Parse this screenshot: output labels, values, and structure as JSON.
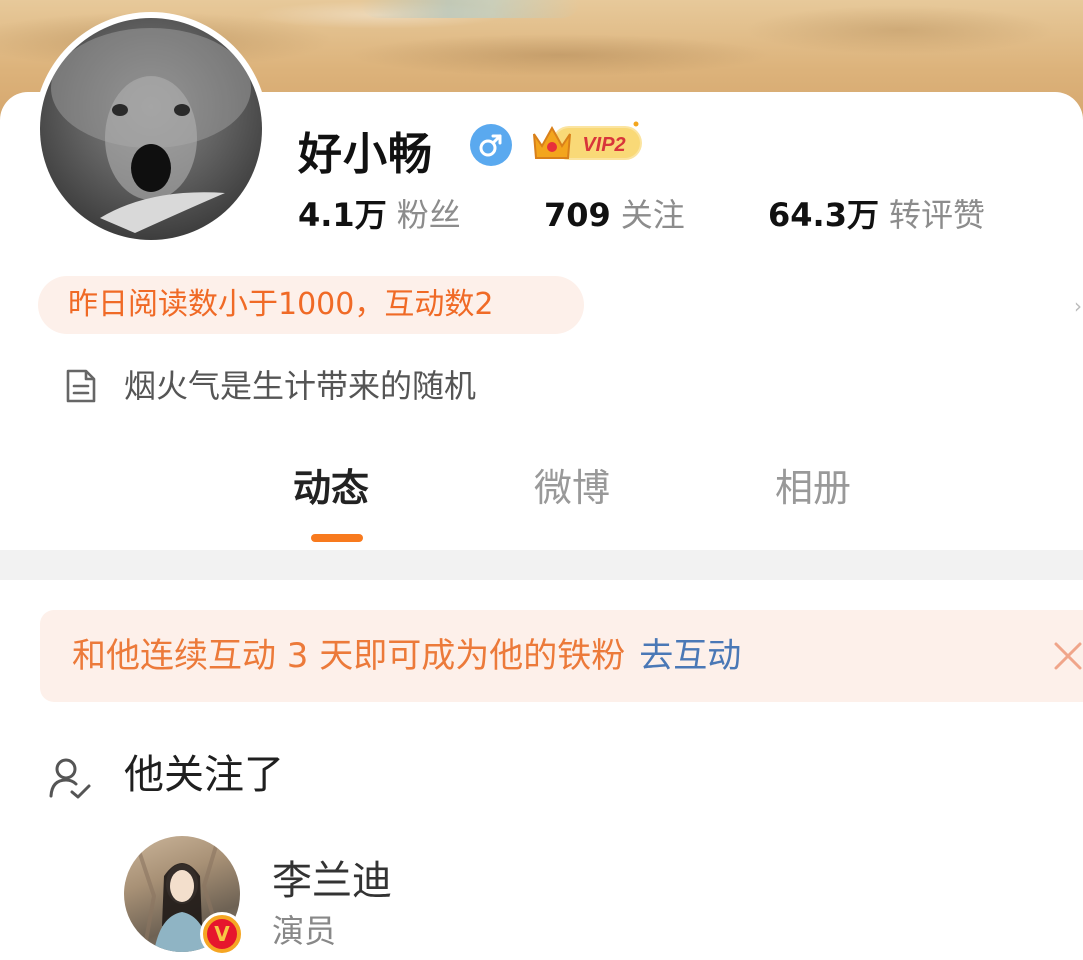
{
  "profile": {
    "name": "好小畅",
    "gender_icon": "male-icon",
    "vip_label": "VIP2",
    "stats": [
      {
        "value": "4.1万",
        "label": "粉丝"
      },
      {
        "value": "709",
        "label": "关注"
      },
      {
        "value": "64.3万",
        "label": "转评赞"
      }
    ],
    "reading_note": "昨日阅读数小于1000，互动数2",
    "bio": "烟火气是生计带来的随机"
  },
  "tabs": [
    {
      "label": "动态",
      "active": true
    },
    {
      "label": "微博",
      "active": false
    },
    {
      "label": "相册",
      "active": false
    }
  ],
  "notice": {
    "text": "和他连续互动 3 天即可成为他的铁粉",
    "link": "去互动"
  },
  "following": {
    "title": "他关注了",
    "users": [
      {
        "name": "李兰迪",
        "description": "演员"
      }
    ]
  },
  "colors": {
    "accent": "#f87a1e",
    "reading_text": "#f06a26",
    "link": "#4a78b6",
    "gender": "#5aa9ef"
  }
}
